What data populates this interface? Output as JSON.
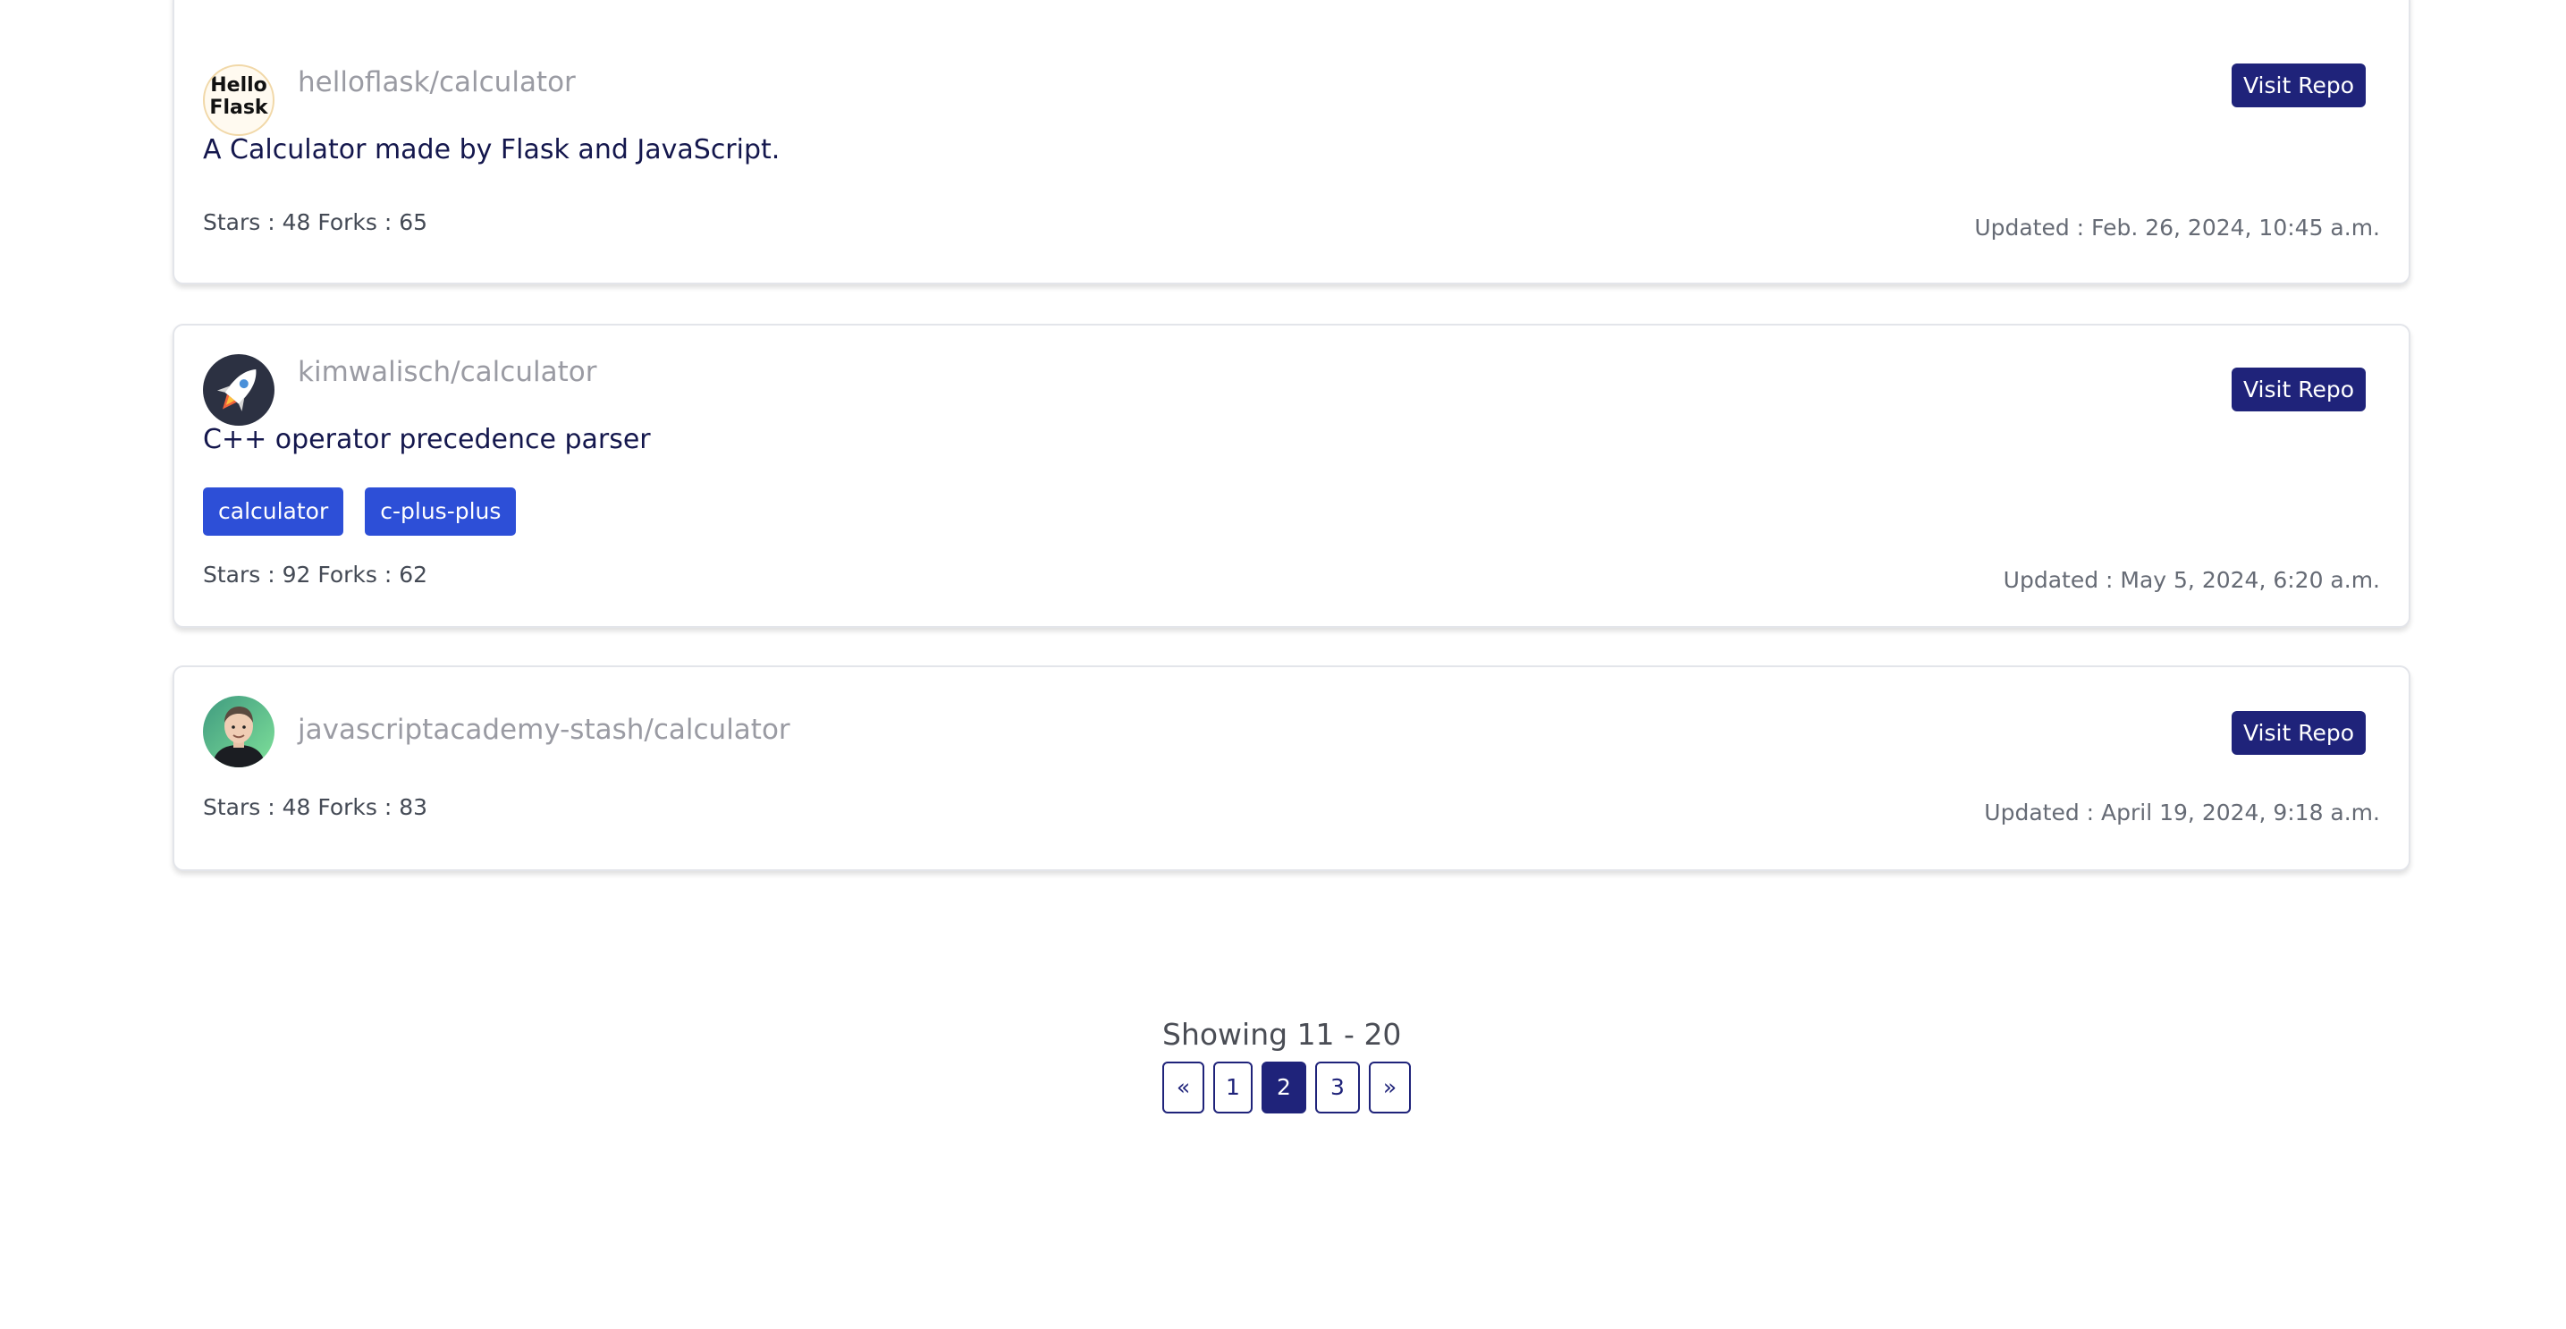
{
  "repos": [
    {
      "name": "helloflask/calculator",
      "avatar_text_1": "Hello",
      "avatar_text_2": "Flask",
      "description": "A Calculator made by Flask and JavaScript.",
      "tags": [],
      "stars_forks": "Stars : 48  Forks : 65",
      "updated": "Updated : Feb. 26, 2024, 10:45 a.m.",
      "button_label": "Visit Repo"
    },
    {
      "name": "kimwalisch/calculator",
      "avatar_icon": "rocket-icon",
      "description": "C++ operator precedence parser",
      "tags": [
        "calculator",
        "c-plus-plus"
      ],
      "stars_forks": "Stars : 92  Forks : 62",
      "updated": "Updated : May 5, 2024, 6:20 a.m.",
      "button_label": "Visit Repo"
    },
    {
      "name": "javascriptacademy-stash/calculator",
      "avatar_icon": "person-photo",
      "description": "",
      "tags": [],
      "stars_forks": "Stars : 48  Forks : 83",
      "updated": "Updated : April 19, 2024, 9:18 a.m.",
      "button_label": "Visit Repo"
    }
  ],
  "pagination": {
    "showing": "Showing 11 - 20",
    "prev": "«",
    "pages": [
      "1",
      "2",
      "3"
    ],
    "current": "2",
    "next": "»"
  },
  "colors": {
    "primary": "#1f237a",
    "tag": "#2d4fd7",
    "repo_name": "#9a9ba3",
    "description": "#14174d"
  }
}
